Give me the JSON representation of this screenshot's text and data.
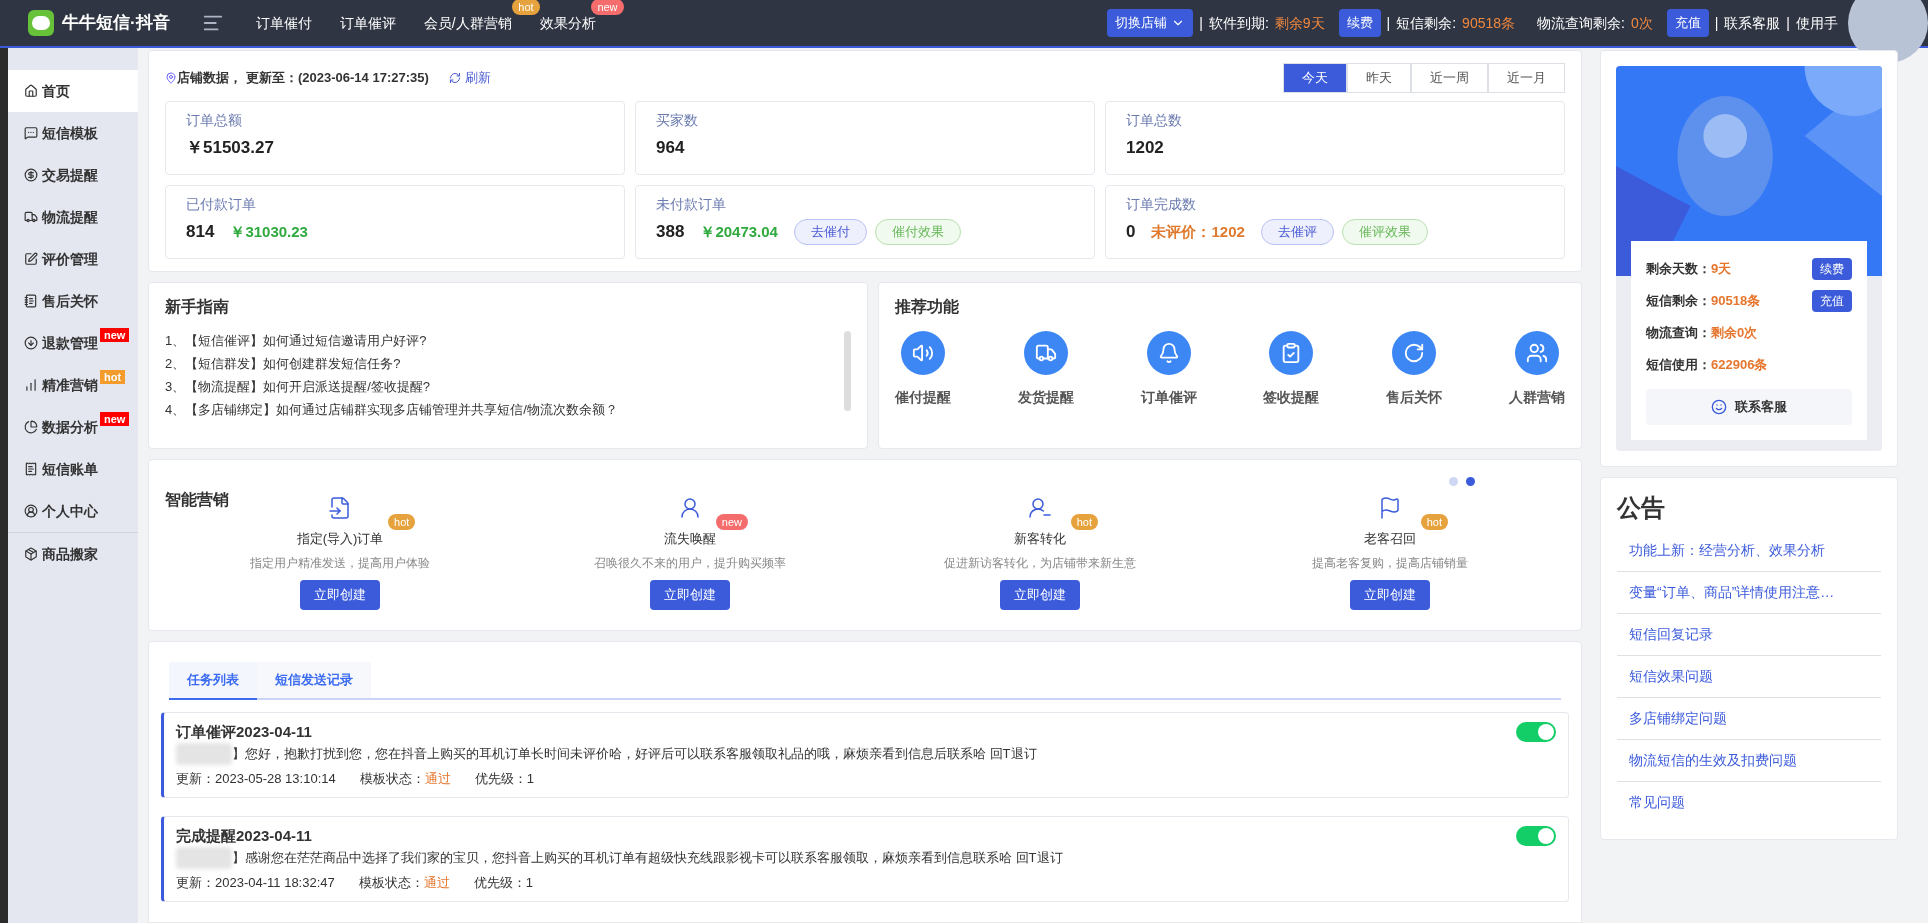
{
  "header": {
    "logo_text": "牛牛短信·抖音",
    "nav": [
      {
        "label": "订单催付"
      },
      {
        "label": "订单催评"
      },
      {
        "label": "会员/人群营销",
        "badge": {
          "text": "hot",
          "color": "#e6a23c"
        }
      },
      {
        "label": "效果分析",
        "badge": {
          "text": "new",
          "color": "#f56c6c"
        }
      }
    ],
    "switch_shop": "切换店铺",
    "sep1": "|",
    "expire_label": "软件到期:",
    "expire_value": "剩余9天",
    "renew": "续费",
    "sep2": "|",
    "sms_label": "短信剩余:",
    "sms_value": "90518条",
    "logistics_label": "物流查询剩余:",
    "logistics_value": "0次",
    "recharge": "充值",
    "sep3": "|",
    "service": "联系客服",
    "sep4": "|",
    "use_hint": "使用手"
  },
  "sidebar": {
    "items": [
      {
        "label": "首页",
        "selected": true
      },
      {
        "label": "短信模板",
        "selected": false
      },
      {
        "label": "交易提醒",
        "selected": false
      },
      {
        "label": "物流提醒",
        "selected": false
      },
      {
        "label": "评价管理",
        "selected": false
      },
      {
        "label": "售后关怀",
        "selected": false
      },
      {
        "label": "退款管理",
        "selected": false,
        "badge": {
          "text": "new",
          "color": "#ff0000"
        }
      },
      {
        "label": "精准营销",
        "selected": false,
        "badge": {
          "text": "hot",
          "color": "#f39c2c"
        }
      },
      {
        "label": "数据分析",
        "selected": false,
        "badge": {
          "text": "new",
          "color": "#ff0000"
        }
      },
      {
        "label": "短信账单",
        "selected": false
      },
      {
        "label": "个人中心",
        "selected": false
      }
    ],
    "extra": [
      {
        "label": "商品搬家",
        "selected": false
      }
    ]
  },
  "shop_data": {
    "title": "店铺数据，",
    "updated": "更新至：(2023-06-14 17:27:35)",
    "refresh": "刷新",
    "ranges": [
      {
        "label": "今天",
        "selected": true
      },
      {
        "label": "昨天",
        "selected": false
      },
      {
        "label": "近一周",
        "selected": false
      },
      {
        "label": "近一月",
        "selected": false
      }
    ],
    "stats": [
      {
        "label": "订单总额",
        "value": "￥51503.27"
      },
      {
        "label": "买家数",
        "value": "964"
      },
      {
        "label": "订单总数",
        "value": "1202"
      },
      {
        "label": "已付款订单",
        "value": "814",
        "money": "￥31030.23"
      },
      {
        "label": "未付款订单",
        "value": "388",
        "money": "￥20473.04",
        "actions": [
          "去催付",
          "催付效果"
        ]
      },
      {
        "label": "订单完成数",
        "value": "0",
        "pending": "未评价：1202",
        "actions": [
          "去催评",
          "催评效果"
        ]
      }
    ]
  },
  "guide": {
    "title": "新手指南",
    "items": [
      "1、【短信催评】如何通过短信邀请用户好评?",
      "2、【短信群发】如何创建群发短信任务?",
      "3、【物流提醒】如何开启派送提醒/签收提醒?",
      "4、【多店铺绑定】如何通过店铺群实现多店铺管理并共享短信/物流次数余额？"
    ]
  },
  "recommend": {
    "title": "推荐功能",
    "items": [
      {
        "label": "催付提醒"
      },
      {
        "label": "发货提醒"
      },
      {
        "label": "订单催评"
      },
      {
        "label": "签收提醒"
      },
      {
        "label": "售后关怀"
      },
      {
        "label": "人群营销"
      }
    ]
  },
  "smart": {
    "title": "智能营销",
    "dots": [
      {
        "selected": false
      },
      {
        "selected": true
      }
    ],
    "items": [
      {
        "title": "指定(导入)订单",
        "badge": {
          "text": "hot",
          "color": "#e6a23c"
        },
        "desc": "指定用户精准发送，提高用户体验",
        "button": "立即创建"
      },
      {
        "title": "流失唤醒",
        "badge": {
          "text": "new",
          "color": "#f56c6c"
        },
        "desc": "召唤很久不来的用户，提升购买频率",
        "button": "立即创建"
      },
      {
        "title": "新客转化",
        "badge": {
          "text": "hot",
          "color": "#e6a23c"
        },
        "desc": "促进新访客转化，为店铺带来新生意",
        "button": "立即创建"
      },
      {
        "title": "老客召回",
        "badge": {
          "text": "hot",
          "color": "#e6a23c"
        },
        "desc": "提高老客复购，提高店铺销量",
        "button": "立即创建"
      }
    ]
  },
  "tasks": {
    "tabs": [
      {
        "label": "任务列表",
        "selected": true
      },
      {
        "label": "短信发送记录",
        "selected": false
      }
    ],
    "items": [
      {
        "title": "订单催评2023-04-11",
        "on": true,
        "message": "】您好，抱歉打扰到您，您在抖音上购买的耳机订单长时间未评价哈，好评后可以联系客服领取礼品的哦，麻烦亲看到信息后联系哈 回T退订",
        "updated": "更新：2023-05-28 13:10:14",
        "status_label": "模板状态：",
        "status": "通过",
        "priority": "优先级：1"
      },
      {
        "title": "完成提醒2023-04-11",
        "on": true,
        "message": "】感谢您在茫茫商品中选择了我们家的宝贝，您抖音上购买的耳机订单有超级快充线跟影视卡可以联系客服领取，麻烦亲看到信息联系哈 回T退订",
        "updated": "更新：2023-04-11 18:32:47",
        "status_label": "模板状态：",
        "status": "通过",
        "priority": "优先级：1"
      }
    ]
  },
  "account": {
    "rows": [
      {
        "label": "剩余天数：",
        "value": "9天",
        "button": "续费"
      },
      {
        "label": "短信剩余：",
        "value": "90518条",
        "button": "充值"
      },
      {
        "label": "物流查询：",
        "value": "剩余0次"
      },
      {
        "label": "短信使用：",
        "value": "622906条"
      }
    ],
    "service": "联系客服"
  },
  "notices": {
    "title": "公告",
    "items": [
      "功能上新：经营分析、效果分析",
      "变量“订单、商品”详情使用注意…",
      "短信回复记录",
      "短信效果问题",
      "多店铺绑定问题",
      "物流短信的生效及扣费问题",
      "常见问题"
    ]
  }
}
